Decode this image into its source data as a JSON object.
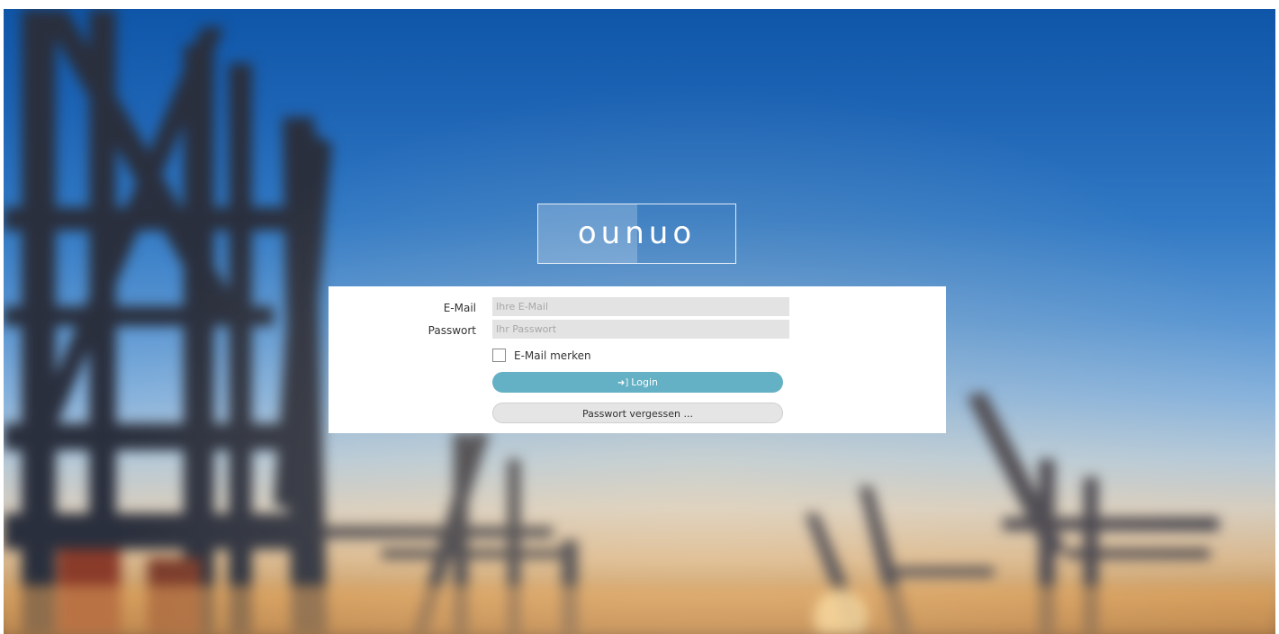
{
  "brand": {
    "logo_text": "ounuo"
  },
  "login_form": {
    "email": {
      "label": "E-Mail",
      "placeholder": "Ihre E-Mail",
      "value": ""
    },
    "password": {
      "label": "Passwort",
      "placeholder": "Ihr Passwort",
      "value": ""
    },
    "remember": {
      "label": "E-Mail merken",
      "checked": false
    },
    "login_button": {
      "label": "Login",
      "icon": "sign-in-icon"
    },
    "forgot_button": {
      "label": "Passwort vergessen ..."
    }
  },
  "colors": {
    "login_button": "#64b0c5",
    "input_background": "#e3e3e3",
    "panel_background": "#ffffff",
    "sky_top": "#0f56a8"
  }
}
